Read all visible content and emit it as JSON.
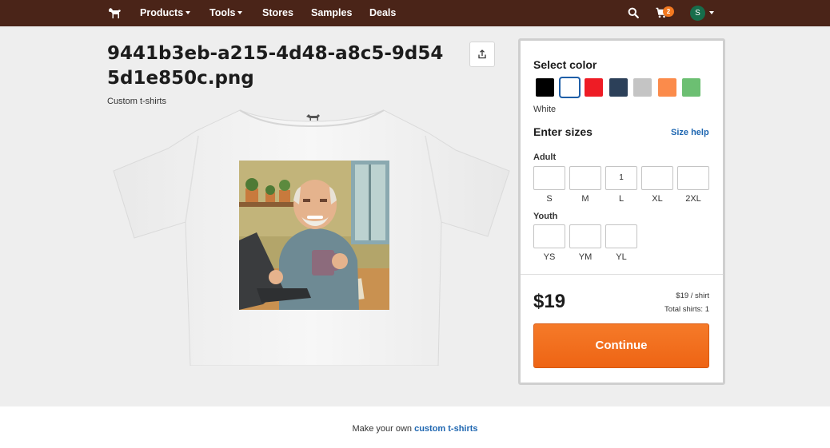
{
  "nav": {
    "products": "Products",
    "tools": "Tools",
    "stores": "Stores",
    "samples": "Samples",
    "deals": "Deals",
    "cart_count": "2",
    "avatar_initial": "S",
    "icons": [
      "horse-logo-icon",
      "search-icon",
      "cart-icon",
      "chevron-down-icon"
    ]
  },
  "product": {
    "title": "9441b3eb-a215-4d48-a8c5-9d545d1e850c.png",
    "subtitle": "Custom t-shirts"
  },
  "panel": {
    "select_color": "Select color",
    "colors": [
      {
        "name": "Black",
        "hex": "#000000"
      },
      {
        "name": "White",
        "hex": "#ffffff"
      },
      {
        "name": "Red",
        "hex": "#ee1c25"
      },
      {
        "name": "Navy",
        "hex": "#2c4059"
      },
      {
        "name": "Gray",
        "hex": "#c4c4c4"
      },
      {
        "name": "Orange",
        "hex": "#fb8b4b"
      },
      {
        "name": "Green",
        "hex": "#6cbf72"
      }
    ],
    "selected_color": "White",
    "enter_sizes": "Enter sizes",
    "size_help": "Size help",
    "adult_label": "Adult",
    "adult_sizes": [
      {
        "label": "S",
        "value": ""
      },
      {
        "label": "M",
        "value": ""
      },
      {
        "label": "L",
        "value": "1"
      },
      {
        "label": "XL",
        "value": ""
      },
      {
        "label": "2XL",
        "value": ""
      }
    ],
    "youth_label": "Youth",
    "youth_sizes": [
      {
        "label": "YS",
        "value": ""
      },
      {
        "label": "YM",
        "value": ""
      },
      {
        "label": "YL",
        "value": ""
      }
    ],
    "price": "$19",
    "per_shirt": "$19 / shirt",
    "total_shirts": "Total shirts: 1",
    "continue": "Continue"
  },
  "footer": {
    "prefix": "Make your own",
    "link": "custom t-shirts"
  },
  "colors": {
    "nav_bg": "#4a2418",
    "accent": "#f26d1d",
    "link": "#1f67b1"
  }
}
